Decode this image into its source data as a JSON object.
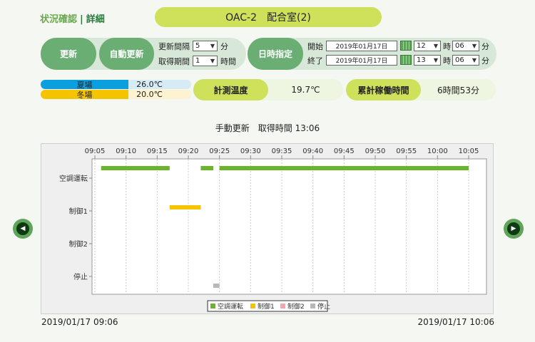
{
  "tabs": {
    "status": "状況確認",
    "separator": "|",
    "detail": "詳細"
  },
  "device_title": "OAC-2　配合室(2)",
  "controls": {
    "refresh_button": "更新",
    "auto_refresh_button": "自動更新",
    "interval_label": "更新間隔",
    "interval_value": "5",
    "interval_unit": "分",
    "period_label": "取得期間",
    "period_value": "1",
    "period_unit": "時間",
    "time_specify_button": "日時指定",
    "start_label": "開始",
    "start_date": "2019年01月17日",
    "start_hour": "12",
    "start_minute": "06",
    "end_label": "終了",
    "end_date": "2019年01月17日",
    "end_hour": "13",
    "end_minute": "06",
    "hour_unit": "時",
    "minute_unit": "分"
  },
  "modes": {
    "summer_label": "夏場",
    "summer_value": "26.0℃",
    "summer_color": "#0aa0e0",
    "winter_label": "冬場",
    "winter_value": "20.0℃",
    "winter_color": "#f5c400"
  },
  "measured_temp": {
    "label": "計測温度",
    "value": "19.7℃"
  },
  "cumulative": {
    "label": "累計稼働時間",
    "value": "6時間53分"
  },
  "update_status": "手動更新　取得時間 13:06",
  "footer": {
    "start_time": "2019/01/17 09:06",
    "end_time": "2019/01/17 10:06"
  },
  "nav": {
    "prev_icon": "left-arrow-icon",
    "next_icon": "right-arrow-icon"
  },
  "chart_data": {
    "type": "timeline",
    "x_ticks": [
      "09:05",
      "09:10",
      "09:15",
      "09:20",
      "09:25",
      "09:30",
      "09:35",
      "09:40",
      "09:45",
      "09:50",
      "09:55",
      "10:00",
      "10:05"
    ],
    "categories": [
      "空調運転",
      "制御1",
      "制御2",
      "停止"
    ],
    "series": [
      {
        "name": "空調運転",
        "color": "#6ab42c",
        "segments": [
          [
            "09:06",
            "09:17"
          ],
          [
            "09:22",
            "09:24"
          ],
          [
            "09:25",
            "10:05"
          ]
        ]
      },
      {
        "name": "制御1",
        "color": "#f5c400",
        "segments": [
          [
            "09:17",
            "09:22"
          ]
        ]
      },
      {
        "name": "制御2",
        "color": "#f2a6b4",
        "segments": []
      },
      {
        "name": "停止",
        "color": "#b8b8b8",
        "segments": [
          [
            "09:24",
            "09:25"
          ]
        ]
      }
    ],
    "legend_position": "bottom-center",
    "grid": true
  }
}
